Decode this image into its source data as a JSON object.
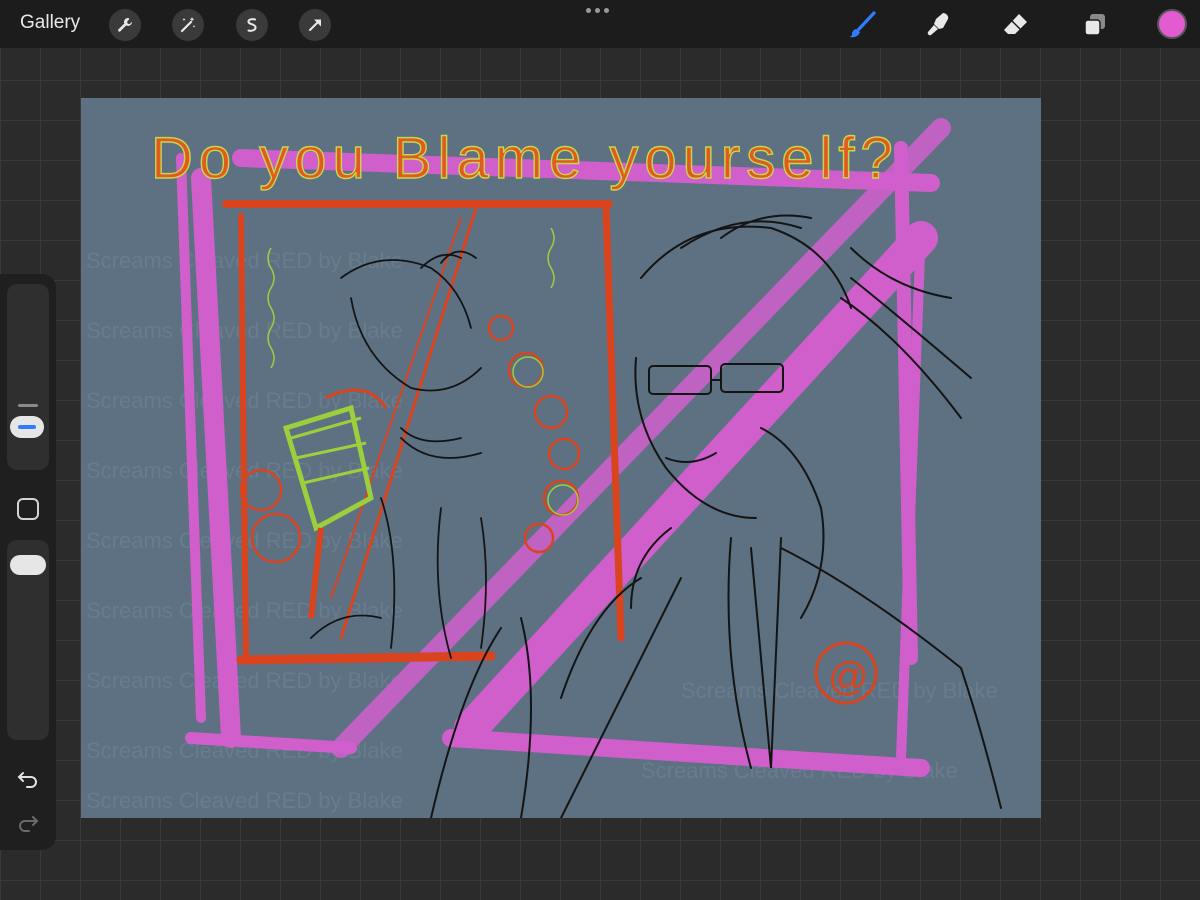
{
  "topbar": {
    "gallery_label": "Gallery",
    "left_tools": [
      "wrench-icon",
      "magic-wand-icon",
      "selection-icon",
      "transform-arrow-icon"
    ],
    "right_tools": [
      "brush-icon",
      "smudge-icon",
      "eraser-icon",
      "layers-icon"
    ],
    "current_color": "#e35bd0",
    "active_tool_color": "#2f7dff"
  },
  "canvas": {
    "background": "#5d7183",
    "title_text": "Do you Blame yourself?",
    "signature": "@",
    "watermark_text": "Screams Cleaved RED by Blake"
  },
  "sidebar": {
    "brush_size_fraction": 0.25,
    "opacity_fraction": 0.9,
    "icons": [
      "brush-size-slider",
      "modify-button",
      "opacity-slider",
      "undo-icon",
      "redo-icon"
    ]
  }
}
